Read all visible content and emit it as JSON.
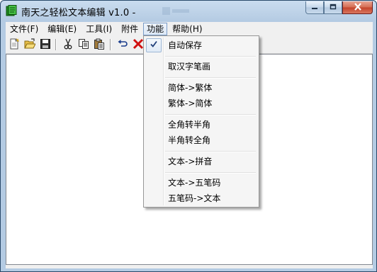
{
  "window": {
    "title": "南天之轻松文本编辑 v1.0  -",
    "minimize_icon": "minimize-icon",
    "maximize_icon": "maximize-icon",
    "close_icon": "close-icon"
  },
  "menubar": {
    "items": [
      {
        "label": "文件(F)"
      },
      {
        "label": "编辑(E)"
      },
      {
        "label": "工具(I)"
      },
      {
        "label": "附件"
      },
      {
        "label": "功能",
        "active": true
      },
      {
        "label": "帮助(H)"
      }
    ]
  },
  "toolbar": {
    "buttons": [
      "new-file-icon",
      "open-folder-icon",
      "save-icon",
      "cut-icon",
      "copy-icon",
      "paste-icon",
      "undo-icon",
      "delete-icon"
    ]
  },
  "editor": {
    "content": ""
  },
  "function_menu": {
    "items": [
      {
        "label": "自动保存",
        "checked": true
      },
      {
        "label": "取汉字笔画"
      },
      {
        "label": "简体->繁体"
      },
      {
        "label": "繁体->简体"
      },
      {
        "label": "全角转半角"
      },
      {
        "label": "半角转全角"
      },
      {
        "label": "文本->拼音"
      },
      {
        "label": "文本->五笔码"
      },
      {
        "label": "五笔码->文本"
      }
    ]
  },
  "colors": {
    "title_bar": "#c9dcef",
    "menu_highlight": "#dce8f6",
    "close_button": "#c3422a",
    "delete_icon": "#d01010"
  }
}
